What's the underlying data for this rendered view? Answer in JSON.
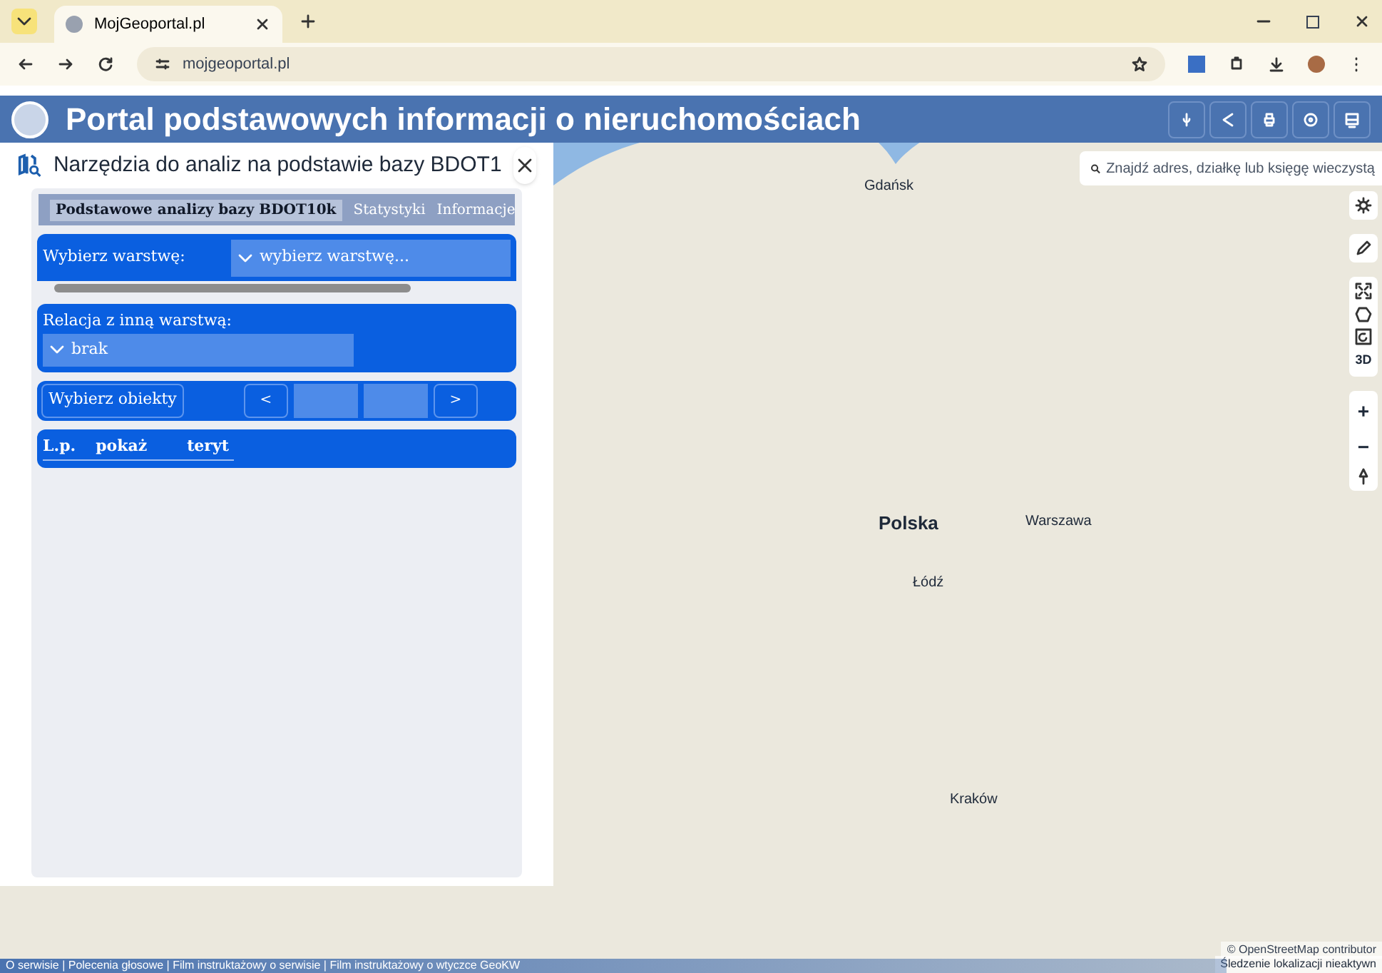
{
  "browser": {
    "tab_title": "MojGeoportal.pl",
    "address": "mojgeoportal.pl"
  },
  "header": {
    "title": "Portal podstawowych informacji o nieruchomościach"
  },
  "panel": {
    "title": "Narzędzia do analiz na podstawie bazy BDOT1",
    "tabs": [
      {
        "label": "Podstawowe analizy bazy BDOT10k",
        "selected": true
      },
      {
        "label": "Statystyki",
        "selected": false
      },
      {
        "label": "Informacje",
        "selected": false
      }
    ],
    "layer_label": "Wybierz warstwę:",
    "layer_value": "wybierz warstwę...",
    "relation_label": "Relacja z inną warstwą:",
    "relation_value": "brak",
    "select_button": "Wybierz obiekty",
    "prev": "<",
    "next": ">",
    "columns": [
      "L.p.",
      "pokaż",
      "teryt"
    ]
  },
  "search": {
    "placeholder": "Znajdź adres, działkę lub księgę wieczystą"
  },
  "map_controls": {
    "three_d": "3D",
    "zoom_in": "+",
    "zoom_out": "−"
  },
  "map_labels": [
    {
      "text": "Gdańsk",
      "kind": "city"
    },
    {
      "text": "Polska",
      "kind": "country"
    },
    {
      "text": "Warszawa",
      "kind": "city"
    },
    {
      "text": "Łódź",
      "kind": "city"
    },
    {
      "text": "Kraków",
      "kind": "city"
    }
  ],
  "attribution": "© OpenStreetMap contributor",
  "tracking": "Śledzenie lokalizacji nieaktywn",
  "footer": "O serwisie | Polecenia głosowe | Film instruktażowy o serwisie | Film instruktażowy o wtyczce GeoKW"
}
